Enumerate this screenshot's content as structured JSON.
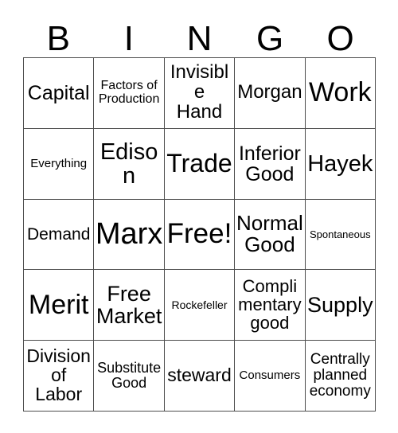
{
  "card": {
    "title": "Bingo Card",
    "background_color": "#ffffff",
    "text_color": "#000000",
    "border_color": "#4d4d4d",
    "columns": 5,
    "rows": 5
  },
  "header": {
    "letters": [
      {
        "label": "B"
      },
      {
        "label": "I"
      },
      {
        "label": "N"
      },
      {
        "label": "G"
      },
      {
        "label": "O"
      }
    ]
  },
  "grid": {
    "cells": [
      {
        "text": "Capital",
        "size": 25,
        "lines": 1,
        "free": false
      },
      {
        "text": "Factors of\nProduction",
        "size": 16,
        "lines": 2,
        "free": false
      },
      {
        "text": "Invisible\nHand",
        "size": 24,
        "lines": 2,
        "free": false
      },
      {
        "text": "Morgan",
        "size": 24,
        "lines": 1,
        "free": false
      },
      {
        "text": "Work",
        "size": 34,
        "lines": 1,
        "free": false
      },
      {
        "text": "Everything",
        "size": 15,
        "lines": 1,
        "free": false
      },
      {
        "text": "Edison",
        "size": 29,
        "lines": 1,
        "free": false
      },
      {
        "text": "Trade",
        "size": 32,
        "lines": 1,
        "free": false
      },
      {
        "text": "Inferior\nGood",
        "size": 25,
        "lines": 2,
        "free": false
      },
      {
        "text": "Hayek",
        "size": 29,
        "lines": 1,
        "free": false
      },
      {
        "text": "Demand",
        "size": 21,
        "lines": 1,
        "free": false
      },
      {
        "text": "Marx",
        "size": 38,
        "lines": 1,
        "free": false
      },
      {
        "text": "Free!",
        "size": 35,
        "lines": 1,
        "free": true
      },
      {
        "text": "Normal\nGood",
        "size": 26,
        "lines": 2,
        "free": false
      },
      {
        "text": "Spontaneous",
        "size": 13,
        "lines": 1,
        "free": false
      },
      {
        "text": "Merit",
        "size": 34,
        "lines": 1,
        "free": false
      },
      {
        "text": "Free\nMarket",
        "size": 27,
        "lines": 2,
        "free": false
      },
      {
        "text": "Rockefeller",
        "size": 14,
        "lines": 1,
        "free": false
      },
      {
        "text": "Compli\nmentary\ngood",
        "size": 22,
        "lines": 3,
        "free": false
      },
      {
        "text": "Supply",
        "size": 27,
        "lines": 1,
        "free": false
      },
      {
        "text": "Division\nof\nLabor",
        "size": 23,
        "lines": 3,
        "free": false
      },
      {
        "text": "Substitute\nGood",
        "size": 18,
        "lines": 2,
        "free": false
      },
      {
        "text": "steward",
        "size": 23,
        "lines": 1,
        "free": false
      },
      {
        "text": "Consumers",
        "size": 15,
        "lines": 1,
        "free": false
      },
      {
        "text": "Centrally\nplanned\neconomy",
        "size": 19,
        "lines": 3,
        "free": false
      }
    ]
  }
}
